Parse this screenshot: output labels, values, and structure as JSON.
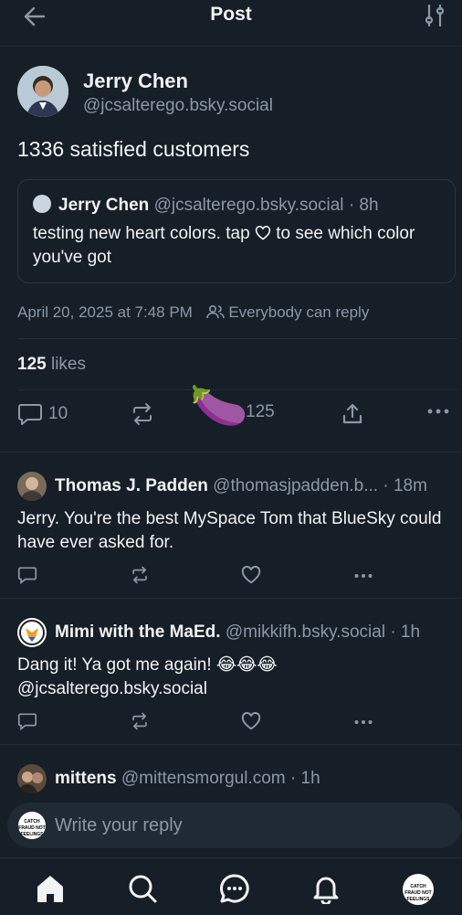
{
  "header": {
    "title": "Post"
  },
  "post": {
    "author_name": "Jerry Chen",
    "author_handle": "@jcsalterego.bsky.social",
    "text": "1336 satisfied customers",
    "quote": {
      "author_name": "Jerry Chen",
      "author_handle": "@jcsalterego.bsky.social",
      "time": "· 8h",
      "text_1": "testing new heart colors. tap ",
      "text_2": " to see which color you've got"
    },
    "timestamp": "April 20, 2025 at 7:48 PM",
    "reply_setting": "Everybody can reply",
    "likes_count": "125",
    "likes_label": "likes",
    "reply_count": "10",
    "like_count": "125",
    "reaction_emoji": "🍆"
  },
  "replies": [
    {
      "name": "Thomas J. Padden",
      "handle": "@thomasjpadden.b...",
      "time": "· 18m",
      "text": "Jerry. You're the best MySpace Tom that BlueSky could have ever asked for."
    },
    {
      "name": "Mimi with the MaEd.",
      "handle": "@mikkifh.bsky.social",
      "time": "· 1h",
      "text": "Dang it! Ya got me again! 😂😂😂 @jcsalterego.bsky.social"
    },
    {
      "name": "mittens",
      "handle": "@mittensmorgul.com",
      "time": "· 1h",
      "text": ""
    }
  ],
  "composer": {
    "placeholder": "Write your reply",
    "avatar_text": "CATCH FRAUD NOT FEELINGS"
  },
  "nav": {
    "avatar_text": "CATCH FRAUD NOT FEELINGS"
  },
  "colors": {
    "background": "#161e27",
    "muted": "#8b98a5",
    "divider": "#232e3a"
  }
}
